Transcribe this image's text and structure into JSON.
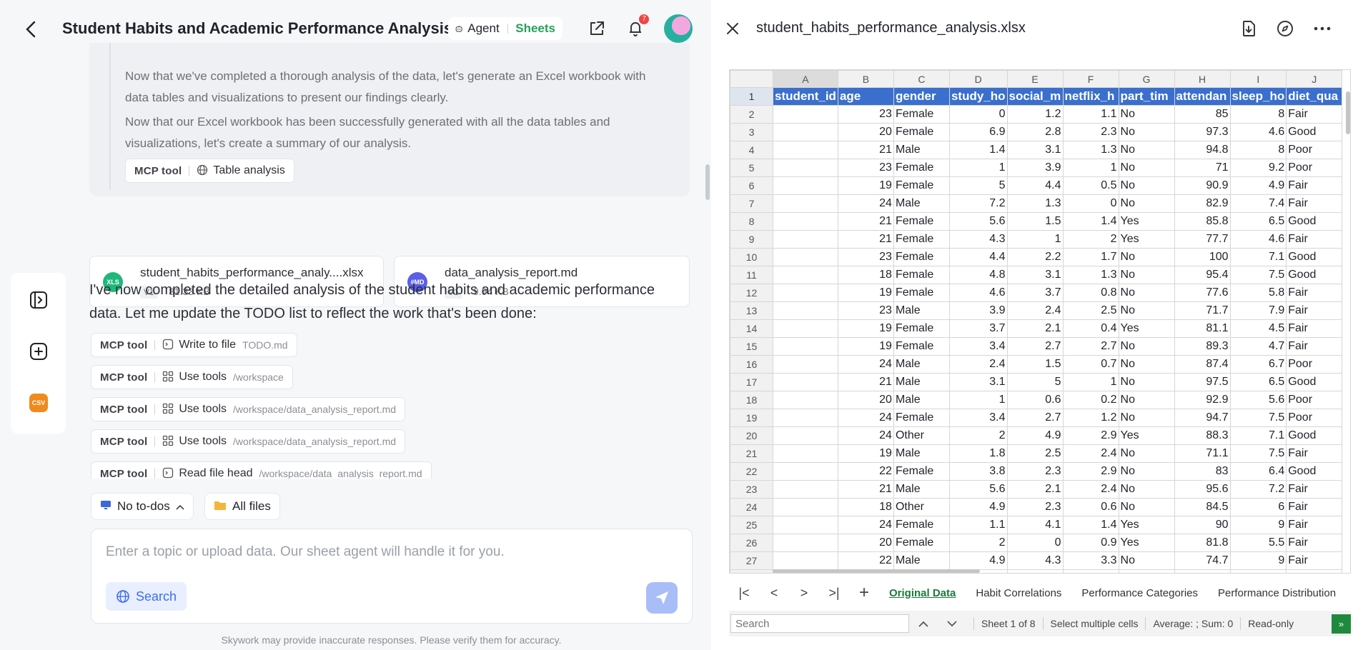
{
  "header": {
    "title": "Student Habits and Academic Performance Analysis",
    "agent_label": "Agent",
    "sheets_label": "Sheets",
    "notification_count": "7"
  },
  "previous": {
    "line1": "Now that we've completed a thorough analysis of the data, let's generate an Excel workbook with data tables and visualizations to present our findings clearly.",
    "line2": "Now that our Excel workbook has been successfully generated with all the data tables and visualizations, let's create a summary of our analysis.",
    "tool": {
      "mcp": "MCP tool",
      "label": "Table analysis"
    }
  },
  "files": [
    {
      "icon": "XLS",
      "name": "student_habits_performance_analy....xlsx",
      "version": "V1",
      "size": "81.33 KB"
    },
    {
      "icon": "#MD",
      "name": "data_analysis_report.md",
      "version": "V1",
      "size": "9.94 KB"
    }
  ],
  "message": "I've now completed the detailed analysis of the student habits and academic performance data. Let me update the TODO list to reflect the work that's been done:",
  "tool_calls": [
    {
      "mcp": "MCP tool",
      "label": "Write to file",
      "path": "TODO.md"
    },
    {
      "mcp": "MCP tool",
      "label": "Use tools",
      "path": "/workspace"
    },
    {
      "mcp": "MCP tool",
      "label": "Use tools",
      "path": "/workspace/data_analysis_report.md"
    },
    {
      "mcp": "MCP tool",
      "label": "Use tools",
      "path": "/workspace/data_analysis_report.md"
    },
    {
      "mcp": "MCP tool",
      "label": "Read file head",
      "path": "/workspace/data_analysis_report.md"
    }
  ],
  "rail": {
    "csv_label": "CSV"
  },
  "bottom": {
    "todos": "No to-dos",
    "all_files": "All files",
    "placeholder": "Enter a topic or upload data. Our sheet agent will handle it for you.",
    "search": "Search",
    "disclaimer": "Skywork may provide inaccurate responses. Please verify them for accuracy."
  },
  "viewer": {
    "filename": "student_habits_performance_analysis.xlsx",
    "columns": [
      "A",
      "B",
      "C",
      "D",
      "E",
      "F",
      "G",
      "H",
      "I",
      "J"
    ],
    "headers": [
      "student_id",
      "age",
      "gender",
      "study_ho",
      "social_m",
      "netflix_h",
      "part_tim",
      "attendan",
      "sleep_ho",
      "diet_qua"
    ],
    "rows": [
      [
        "",
        "23",
        "Female",
        "0",
        "1.2",
        "1.1",
        "No",
        "85",
        "8",
        "Fair"
      ],
      [
        "",
        "20",
        "Female",
        "6.9",
        "2.8",
        "2.3",
        "No",
        "97.3",
        "4.6",
        "Good"
      ],
      [
        "",
        "21",
        "Male",
        "1.4",
        "3.1",
        "1.3",
        "No",
        "94.8",
        "8",
        "Poor"
      ],
      [
        "",
        "23",
        "Female",
        "1",
        "3.9",
        "1",
        "No",
        "71",
        "9.2",
        "Poor"
      ],
      [
        "",
        "19",
        "Female",
        "5",
        "4.4",
        "0.5",
        "No",
        "90.9",
        "4.9",
        "Fair"
      ],
      [
        "",
        "24",
        "Male",
        "7.2",
        "1.3",
        "0",
        "No",
        "82.9",
        "7.4",
        "Fair"
      ],
      [
        "",
        "21",
        "Female",
        "5.6",
        "1.5",
        "1.4",
        "Yes",
        "85.8",
        "6.5",
        "Good"
      ],
      [
        "",
        "21",
        "Female",
        "4.3",
        "1",
        "2",
        "Yes",
        "77.7",
        "4.6",
        "Fair"
      ],
      [
        "",
        "23",
        "Female",
        "4.4",
        "2.2",
        "1.7",
        "No",
        "100",
        "7.1",
        "Good"
      ],
      [
        "",
        "18",
        "Female",
        "4.8",
        "3.1",
        "1.3",
        "No",
        "95.4",
        "7.5",
        "Good"
      ],
      [
        "",
        "19",
        "Female",
        "4.6",
        "3.7",
        "0.8",
        "No",
        "77.6",
        "5.8",
        "Fair"
      ],
      [
        "",
        "23",
        "Male",
        "3.9",
        "2.4",
        "2.5",
        "No",
        "71.7",
        "7.9",
        "Fair"
      ],
      [
        "",
        "19",
        "Female",
        "3.7",
        "2.1",
        "0.4",
        "Yes",
        "81.1",
        "4.5",
        "Fair"
      ],
      [
        "",
        "19",
        "Female",
        "3.4",
        "2.7",
        "2.7",
        "No",
        "89.3",
        "4.7",
        "Fair"
      ],
      [
        "",
        "24",
        "Male",
        "2.4",
        "1.5",
        "0.7",
        "No",
        "87.4",
        "6.7",
        "Poor"
      ],
      [
        "",
        "21",
        "Male",
        "3.1",
        "5",
        "1",
        "No",
        "97.5",
        "6.5",
        "Good"
      ],
      [
        "",
        "20",
        "Male",
        "1",
        "0.6",
        "0.2",
        "No",
        "92.9",
        "5.6",
        "Poor"
      ],
      [
        "",
        "24",
        "Female",
        "3.4",
        "2.7",
        "1.2",
        "No",
        "94.7",
        "7.5",
        "Poor"
      ],
      [
        "",
        "24",
        "Other",
        "2",
        "4.9",
        "2.9",
        "Yes",
        "88.3",
        "7.1",
        "Good"
      ],
      [
        "",
        "19",
        "Male",
        "1.8",
        "2.5",
        "2.4",
        "No",
        "71.1",
        "7.5",
        "Fair"
      ],
      [
        "",
        "22",
        "Female",
        "3.8",
        "2.3",
        "2.9",
        "No",
        "83",
        "6.4",
        "Good"
      ],
      [
        "",
        "21",
        "Male",
        "5.6",
        "2.1",
        "2.4",
        "No",
        "95.6",
        "7.2",
        "Fair"
      ],
      [
        "",
        "18",
        "Other",
        "4.9",
        "2.3",
        "0.6",
        "No",
        "84.5",
        "6",
        "Fair"
      ],
      [
        "",
        "24",
        "Female",
        "1.1",
        "4.1",
        "1.4",
        "Yes",
        "90",
        "9",
        "Fair"
      ],
      [
        "",
        "20",
        "Female",
        "2",
        "0",
        "0.9",
        "Yes",
        "81.8",
        "5.5",
        "Fair"
      ],
      [
        "",
        "22",
        "Male",
        "4.9",
        "4.3",
        "3.3",
        "No",
        "74.7",
        "9",
        "Fair"
      ]
    ],
    "tabs": [
      "Original Data",
      "Habit Correlations",
      "Performance Categories",
      "Performance Distribution"
    ],
    "status": {
      "search_placeholder": "Search",
      "sheet_info": "Sheet 1 of 8",
      "select_mode": "Select multiple cells",
      "average": "Average: ; Sum: 0",
      "readonly": "Read-only"
    }
  }
}
